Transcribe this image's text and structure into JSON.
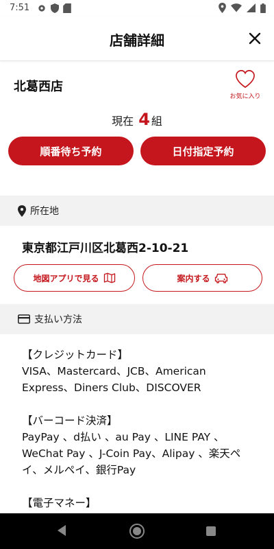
{
  "status_bar": {
    "time": "7:51"
  },
  "header": {
    "title": "店舗詳細"
  },
  "store": {
    "name": "北葛西店",
    "favorite_label": "お気に入り"
  },
  "waiting": {
    "prefix": "現在",
    "count": "4",
    "unit": "組"
  },
  "buttons": {
    "queue_reserve": "順番待ち予約",
    "date_reserve": "日付指定予約",
    "map_app": "地図アプリで見る",
    "guide": "案内する"
  },
  "location": {
    "section_label": "所在地",
    "address": "東京都江戸川区北葛西2-10-21"
  },
  "payment": {
    "section_label": "支払い方法",
    "blocks": [
      {
        "head": "【クレジットカード】",
        "body": " VISA、Mastercard、JCB、American Express、Diners Club、DISCOVER"
      },
      {
        "head": "【バーコード決済】",
        "body": " PayPay 、d払い 、au Pay 、LINE PAY 、WeChat Pay 、J-Coin Pay、Alipay 、楽天ペイ、メルペイ、銀行Pay"
      },
      {
        "head": "【電子マネー】",
        "body": ""
      }
    ]
  },
  "colors": {
    "accent": "#c4161c",
    "section_bg": "#f2f2f2"
  }
}
